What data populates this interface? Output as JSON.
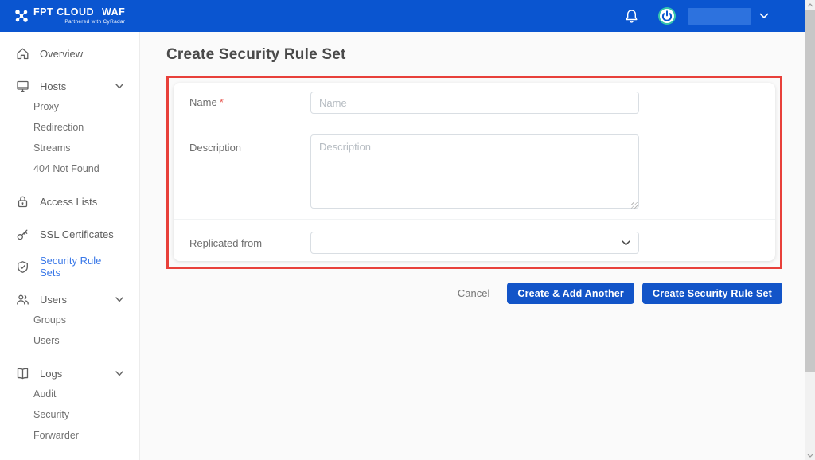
{
  "header": {
    "brand": {
      "name": "FPT CLOUD",
      "product": "WAF",
      "tagline": "Partnered with CyRadar"
    },
    "icons": {
      "notifications": "bell-icon",
      "session": "power-icon",
      "user_menu": "chevron-down-icon"
    }
  },
  "sidebar": {
    "items": [
      {
        "label": "Overview",
        "icon": "home-icon"
      },
      {
        "label": "Hosts",
        "icon": "monitor-icon",
        "expandable": true
      },
      {
        "label": "Proxy"
      },
      {
        "label": "Redirection"
      },
      {
        "label": "Streams"
      },
      {
        "label": "404 Not Found"
      },
      {
        "label": "Access Lists",
        "icon": "lock-icon"
      },
      {
        "label": "SSL Certificates",
        "icon": "key-icon"
      },
      {
        "label": "Security Rule Sets",
        "icon": "shield-check-icon",
        "active": true
      },
      {
        "label": "Users",
        "icon": "users-icon",
        "expandable": true
      },
      {
        "label": "Groups"
      },
      {
        "label": "Users"
      },
      {
        "label": "Logs",
        "icon": "book-icon",
        "expandable": true
      },
      {
        "label": "Audit"
      },
      {
        "label": "Security"
      },
      {
        "label": "Forwarder"
      }
    ]
  },
  "main": {
    "title": "Create Security Rule Set",
    "form": {
      "name": {
        "label": "Name",
        "required_marker": "*",
        "placeholder": "Name",
        "value": ""
      },
      "description": {
        "label": "Description",
        "placeholder": "Description",
        "value": ""
      },
      "replicated_from": {
        "label": "Replicated from",
        "selected_value": "—"
      }
    },
    "actions": {
      "cancel": "Cancel",
      "create_add_another": "Create & Add Another",
      "create": "Create Security Rule Set"
    }
  },
  "colors": {
    "header_blue": "#0a55d0",
    "button_blue": "#1254c8",
    "active_item_blue": "#3b79e8",
    "annotation_red": "#e8403a",
    "power_ring_teal": "#35c4ad"
  }
}
